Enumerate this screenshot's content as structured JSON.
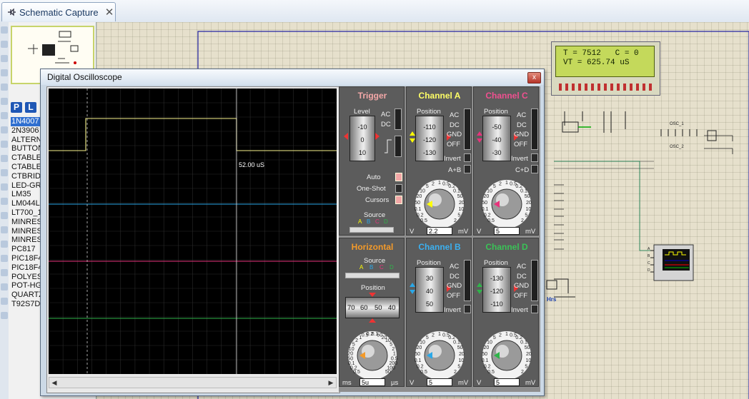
{
  "tab": {
    "title": "Schematic Capture",
    "close": "✕"
  },
  "device_panel": {
    "p_button": "P",
    "l_button": "L",
    "items": [
      "1N4007",
      "2N3906",
      "ALTERN",
      "BUTTON",
      "CTABLE",
      "CTABLE",
      "CTBRIDG",
      "LED-GR",
      "LM35",
      "LM044L",
      "LT700_1",
      "MINRES",
      "MINRES",
      "MINRES",
      "PC817",
      "PIC18F4",
      "PIC18F4",
      "POLYES",
      "POT-HG",
      "QUARTZ",
      "T92S7D"
    ],
    "selected_index": 0
  },
  "lcd": {
    "line1": "T = 7512   C = 0",
    "line2": "VT = 625.74 uS"
  },
  "schematic_labels": {
    "osc1": "OSC_1",
    "osc2": "OSC_2",
    "hrs": "Hrs",
    "scope_a": "A",
    "scope_b": "B",
    "scope_c": "C",
    "scope_d": "D"
  },
  "oscilloscope": {
    "title": "Digital Oscilloscope",
    "close": "x",
    "cursor_readout": "52.00 uS",
    "trace_colors": {
      "a": "#f7f28c",
      "b": "#2aa8e8",
      "c": "#e8337c",
      "d": "#2fb44a"
    },
    "trigger": {
      "title": "Trigger",
      "level_label": "Level",
      "level_ticks": [
        "-10",
        "0",
        "10"
      ],
      "ac": "AC",
      "dc": "DC",
      "auto": "Auto",
      "one_shot": "One-Shot",
      "cursors": "Cursors",
      "source_label": "Source",
      "sources": [
        "A",
        "B",
        "C",
        "D"
      ]
    },
    "horizontal": {
      "title": "Horizontal",
      "source_label": "Source",
      "sources": [
        "A",
        "B",
        "C",
        "D"
      ],
      "position_label": "Position",
      "position_ticks": [
        "70",
        "60",
        "50",
        "40"
      ],
      "dial_ticks": [
        "0.5",
        "0.2",
        "0.1",
        "50",
        "20",
        "10",
        "5",
        "2",
        "1",
        "0.5",
        "0.2",
        "0.1",
        "50",
        "20",
        "10",
        "5",
        "2",
        "1",
        "0.5",
        "200",
        "100",
        "50"
      ],
      "unit_left": "ms",
      "value": "5u",
      "unit_right": "µs"
    },
    "channel_a": {
      "title": "Channel A",
      "position_label": "Position",
      "ticks": [
        "-110",
        "-120",
        "-130"
      ],
      "modes": [
        "AC",
        "DC",
        "GND",
        "OFF"
      ],
      "invert": "Invert",
      "extra": "A+B",
      "unit_left": "V",
      "value": "2.2",
      "unit_right": "mV"
    },
    "channel_b": {
      "title": "Channel B",
      "position_label": "Position",
      "ticks": [
        "30",
        "40",
        "50"
      ],
      "modes": [
        "AC",
        "DC",
        "GND",
        "OFF"
      ],
      "invert": "Invert",
      "unit_left": "V",
      "value": "5",
      "unit_right": "mV"
    },
    "channel_c": {
      "title": "Channel C",
      "position_label": "Position",
      "ticks": [
        "-50",
        "-40",
        "-30"
      ],
      "modes": [
        "AC",
        "DC",
        "GND",
        "OFF"
      ],
      "invert": "Invert",
      "extra": "C+D",
      "unit_left": "V",
      "value": "5",
      "unit_right": "mV"
    },
    "channel_d": {
      "title": "Channel D",
      "position_label": "Position",
      "ticks": [
        "-130",
        "-120",
        "-110"
      ],
      "modes": [
        "AC",
        "DC",
        "GND",
        "OFF"
      ],
      "invert": "Invert",
      "unit_left": "V",
      "value": "5",
      "unit_right": "mV"
    },
    "vdial_ticks": [
      "0.5",
      "0.2",
      "0.1",
      "50",
      "20",
      "10",
      "5",
      "2",
      "1",
      "0.5",
      "0.2",
      "0.1",
      "50",
      "20",
      "10",
      "5",
      "2"
    ]
  }
}
